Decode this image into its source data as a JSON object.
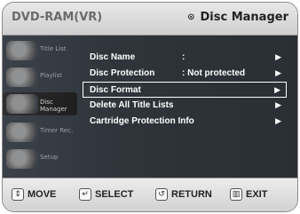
{
  "header": {
    "title": "DVD-RAM(VR)",
    "section": "Disc Manager",
    "section_icon": "disc-icon"
  },
  "sidebar": {
    "items": [
      {
        "label": "Title List",
        "icon": "title-list-icon",
        "active": false
      },
      {
        "label": "Playlist",
        "icon": "playlist-icon",
        "active": false
      },
      {
        "label": "Disc Manager",
        "icon": "disc-manager-icon",
        "active": true
      },
      {
        "label": "Timer Rec.",
        "icon": "timer-icon",
        "active": false
      },
      {
        "label": "Setup",
        "icon": "setup-icon",
        "active": false
      }
    ]
  },
  "menu": {
    "items": [
      {
        "label": "Disc Name",
        "value": ":",
        "selected": false
      },
      {
        "label": "Disc Protection",
        "value": ": Not protected",
        "selected": false
      },
      {
        "label": "Disc Format",
        "value": "",
        "selected": true
      },
      {
        "label": "Delete All Title Lists",
        "value": "",
        "selected": false
      },
      {
        "label": "Cartridge Protection Info",
        "value": "",
        "selected": false
      }
    ],
    "arrow": "▶"
  },
  "footer": {
    "move": "MOVE",
    "select": "SELECT",
    "return": "RETURN",
    "exit": "EXIT"
  },
  "colors": {
    "background": "#2e343a",
    "text": "#ffffff",
    "highlight_border": "#ffffff"
  }
}
